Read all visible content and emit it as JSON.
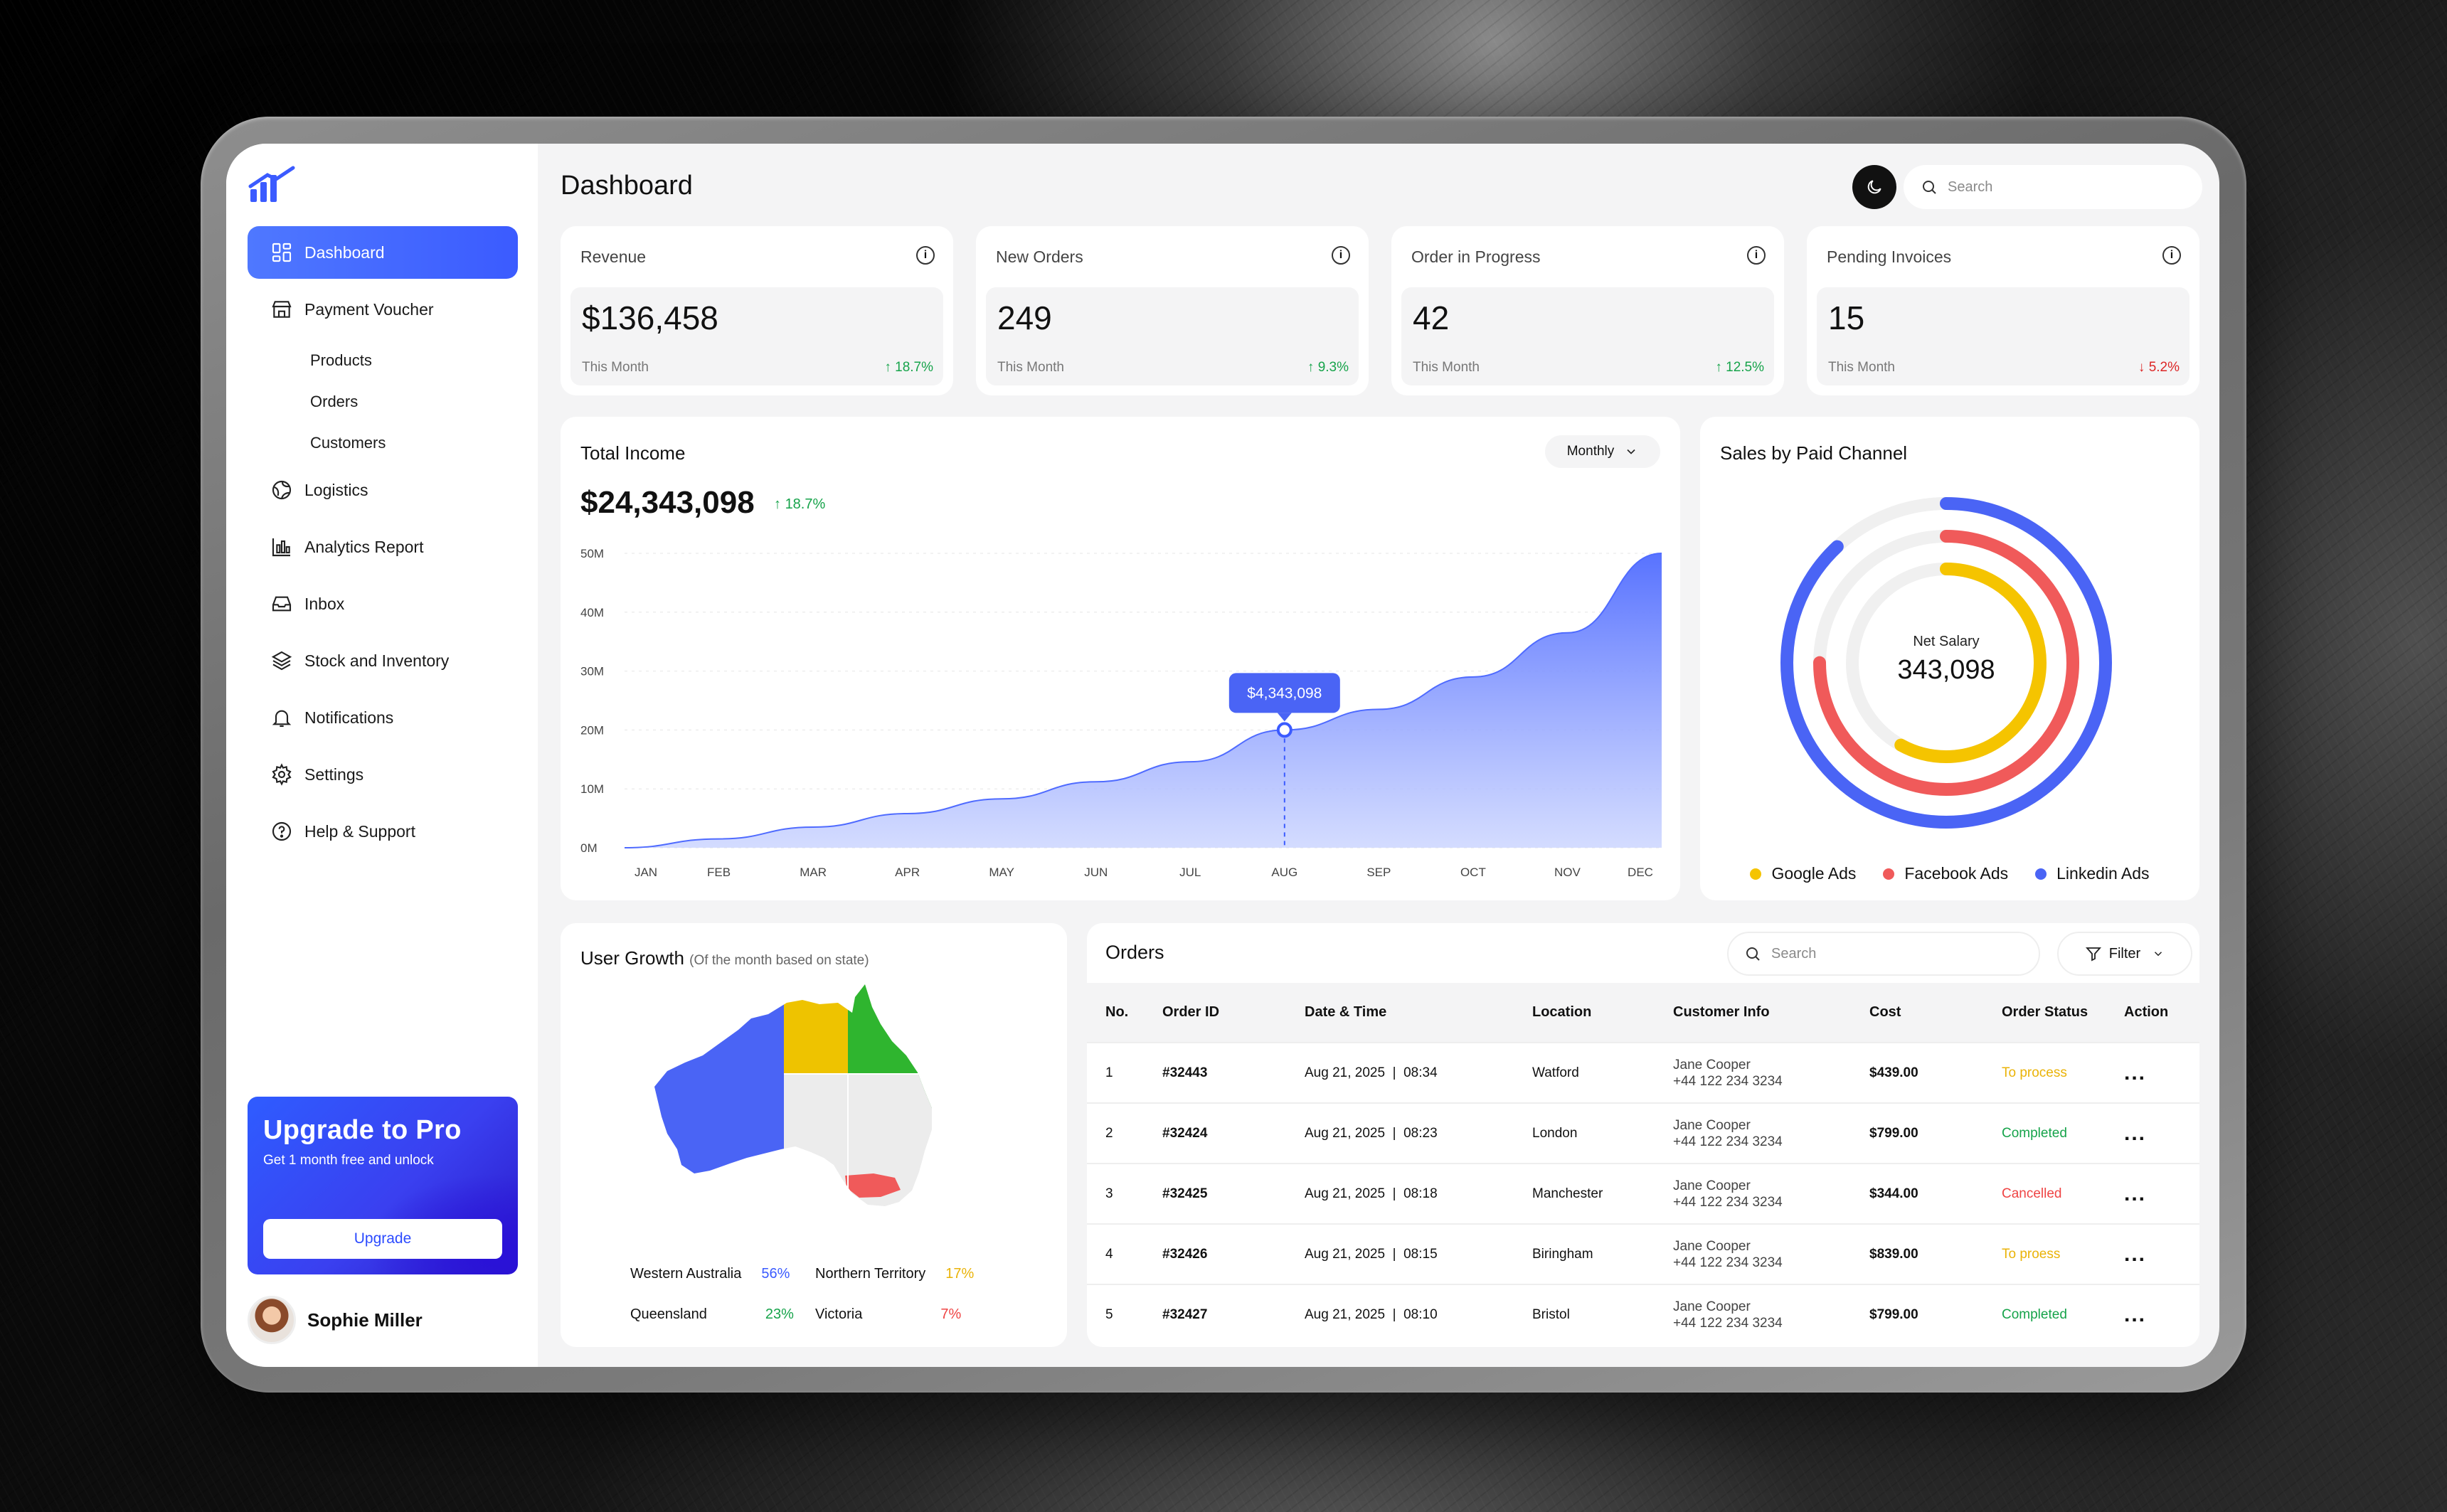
{
  "colors": {
    "accent": "#3b5bff",
    "google": "#f5c400",
    "facebook": "#f05a5a",
    "linkedin": "#4a64f5"
  },
  "sidebar": {
    "items": [
      {
        "label": "Dashboard",
        "icon": "grid-icon"
      },
      {
        "label": "Payment Voucher",
        "icon": "store-icon"
      },
      {
        "label": "Logistics",
        "icon": "globe-icon"
      },
      {
        "label": "Analytics Report",
        "icon": "bar-chart-icon"
      },
      {
        "label": "Inbox",
        "icon": "inbox-icon"
      },
      {
        "label": "Stock and Inventory",
        "icon": "layers-icon"
      },
      {
        "label": "Notifications",
        "icon": "bell-icon"
      },
      {
        "label": "Settings",
        "icon": "gear-icon"
      },
      {
        "label": "Help & Support",
        "icon": "help-icon"
      }
    ],
    "subitems": [
      "Products",
      "Orders",
      "Customers"
    ],
    "promo": {
      "title": "Upgrade to Pro",
      "text": "Get 1 month free and unlock",
      "button": "Upgrade"
    },
    "user": "Sophie Miller"
  },
  "header": {
    "title": "Dashboard",
    "search_placeholder": "Search"
  },
  "stats": [
    {
      "label": "Revenue",
      "value": "$136,458",
      "period": "This Month",
      "change": "18.7%",
      "dir": "up"
    },
    {
      "label": "New Orders",
      "value": "249",
      "period": "This Month",
      "change": "9.3%",
      "dir": "up"
    },
    {
      "label": "Order in Progress",
      "value": "42",
      "period": "This Month",
      "change": "12.5%",
      "dir": "up"
    },
    {
      "label": "Pending Invoices",
      "value": "15",
      "period": "This Month",
      "change": "5.2%",
      "dir": "down"
    }
  ],
  "income": {
    "title": "Total Income",
    "value": "$24,343,098",
    "change": "18.7%",
    "period": "Monthly",
    "tooltip": "$4,343,098"
  },
  "chart_data": {
    "type": "area",
    "title": "Total Income",
    "categories": [
      "JAN",
      "FEB",
      "MAR",
      "APR",
      "MAY",
      "JUN",
      "JUL",
      "AUG",
      "SEP",
      "OCT",
      "NOV",
      "DEC"
    ],
    "y_ticks": [
      "0M",
      "10M",
      "20M",
      "30M",
      "40M",
      "50M"
    ],
    "ylim": [
      0,
      50
    ],
    "values": [
      0,
      1.5,
      3.5,
      5.8,
      8.3,
      11.2,
      14.6,
      20,
      23.5,
      29,
      36.5,
      50
    ],
    "highlight": {
      "category": "AUG",
      "label": "$4,343,098"
    }
  },
  "sales": {
    "title": "Sales by Paid Channel",
    "center_label": "Net Salary",
    "center_value": "343,098",
    "legend": [
      "Google Ads",
      "Facebook Ads",
      "Linkedin Ads"
    ],
    "fractions": [
      0.58,
      0.75,
      0.88
    ]
  },
  "growth": {
    "title": "User Growth",
    "subtitle": "(Of the month based on state)",
    "states": [
      {
        "name": "Western Australia",
        "pct": "56%",
        "color": "#3b5bff"
      },
      {
        "name": "Northern Territory",
        "pct": "17%",
        "color": "#eab308"
      },
      {
        "name": "Queensland",
        "pct": "23%",
        "color": "#16a34a"
      },
      {
        "name": "Victoria",
        "pct": "7%",
        "color": "#ef4444"
      }
    ]
  },
  "orders": {
    "title": "Orders",
    "search_placeholder": "Search",
    "filter": "Filter",
    "columns": [
      "No.",
      "Order ID",
      "Date & Time",
      "Location",
      "Customer Info",
      "Cost",
      "Order Status",
      "Action"
    ],
    "rows": [
      {
        "no": "1",
        "id": "#32443",
        "date": "Aug 21, 2025  |  08:34",
        "loc": "Watford",
        "name": "Jane Cooper",
        "phone": "+44 122 234 3234",
        "cost": "$439.00",
        "status": "To process"
      },
      {
        "no": "2",
        "id": "#32424",
        "date": "Aug 21, 2025  |  08:23",
        "loc": "London",
        "name": "Jane Cooper",
        "phone": "+44 122 234 3234",
        "cost": "$799.00",
        "status": "Completed"
      },
      {
        "no": "3",
        "id": "#32425",
        "date": "Aug 21, 2025  |  08:18",
        "loc": "Manchester",
        "name": "Jane Cooper",
        "phone": "+44 122 234 3234",
        "cost": "$344.00",
        "status": "Cancelled"
      },
      {
        "no": "4",
        "id": "#32426",
        "date": "Aug 21, 2025  |  08:15",
        "loc": "Biringham",
        "name": "Jane Cooper",
        "phone": "+44 122 234 3234",
        "cost": "$839.00",
        "status": "To proess"
      },
      {
        "no": "5",
        "id": "#32427",
        "date": "Aug 21, 2025  |  08:10",
        "loc": "Bristol",
        "name": "Jane Cooper",
        "phone": "+44 122 234 3234",
        "cost": "$799.00",
        "status": "Completed"
      }
    ],
    "action": "..."
  }
}
